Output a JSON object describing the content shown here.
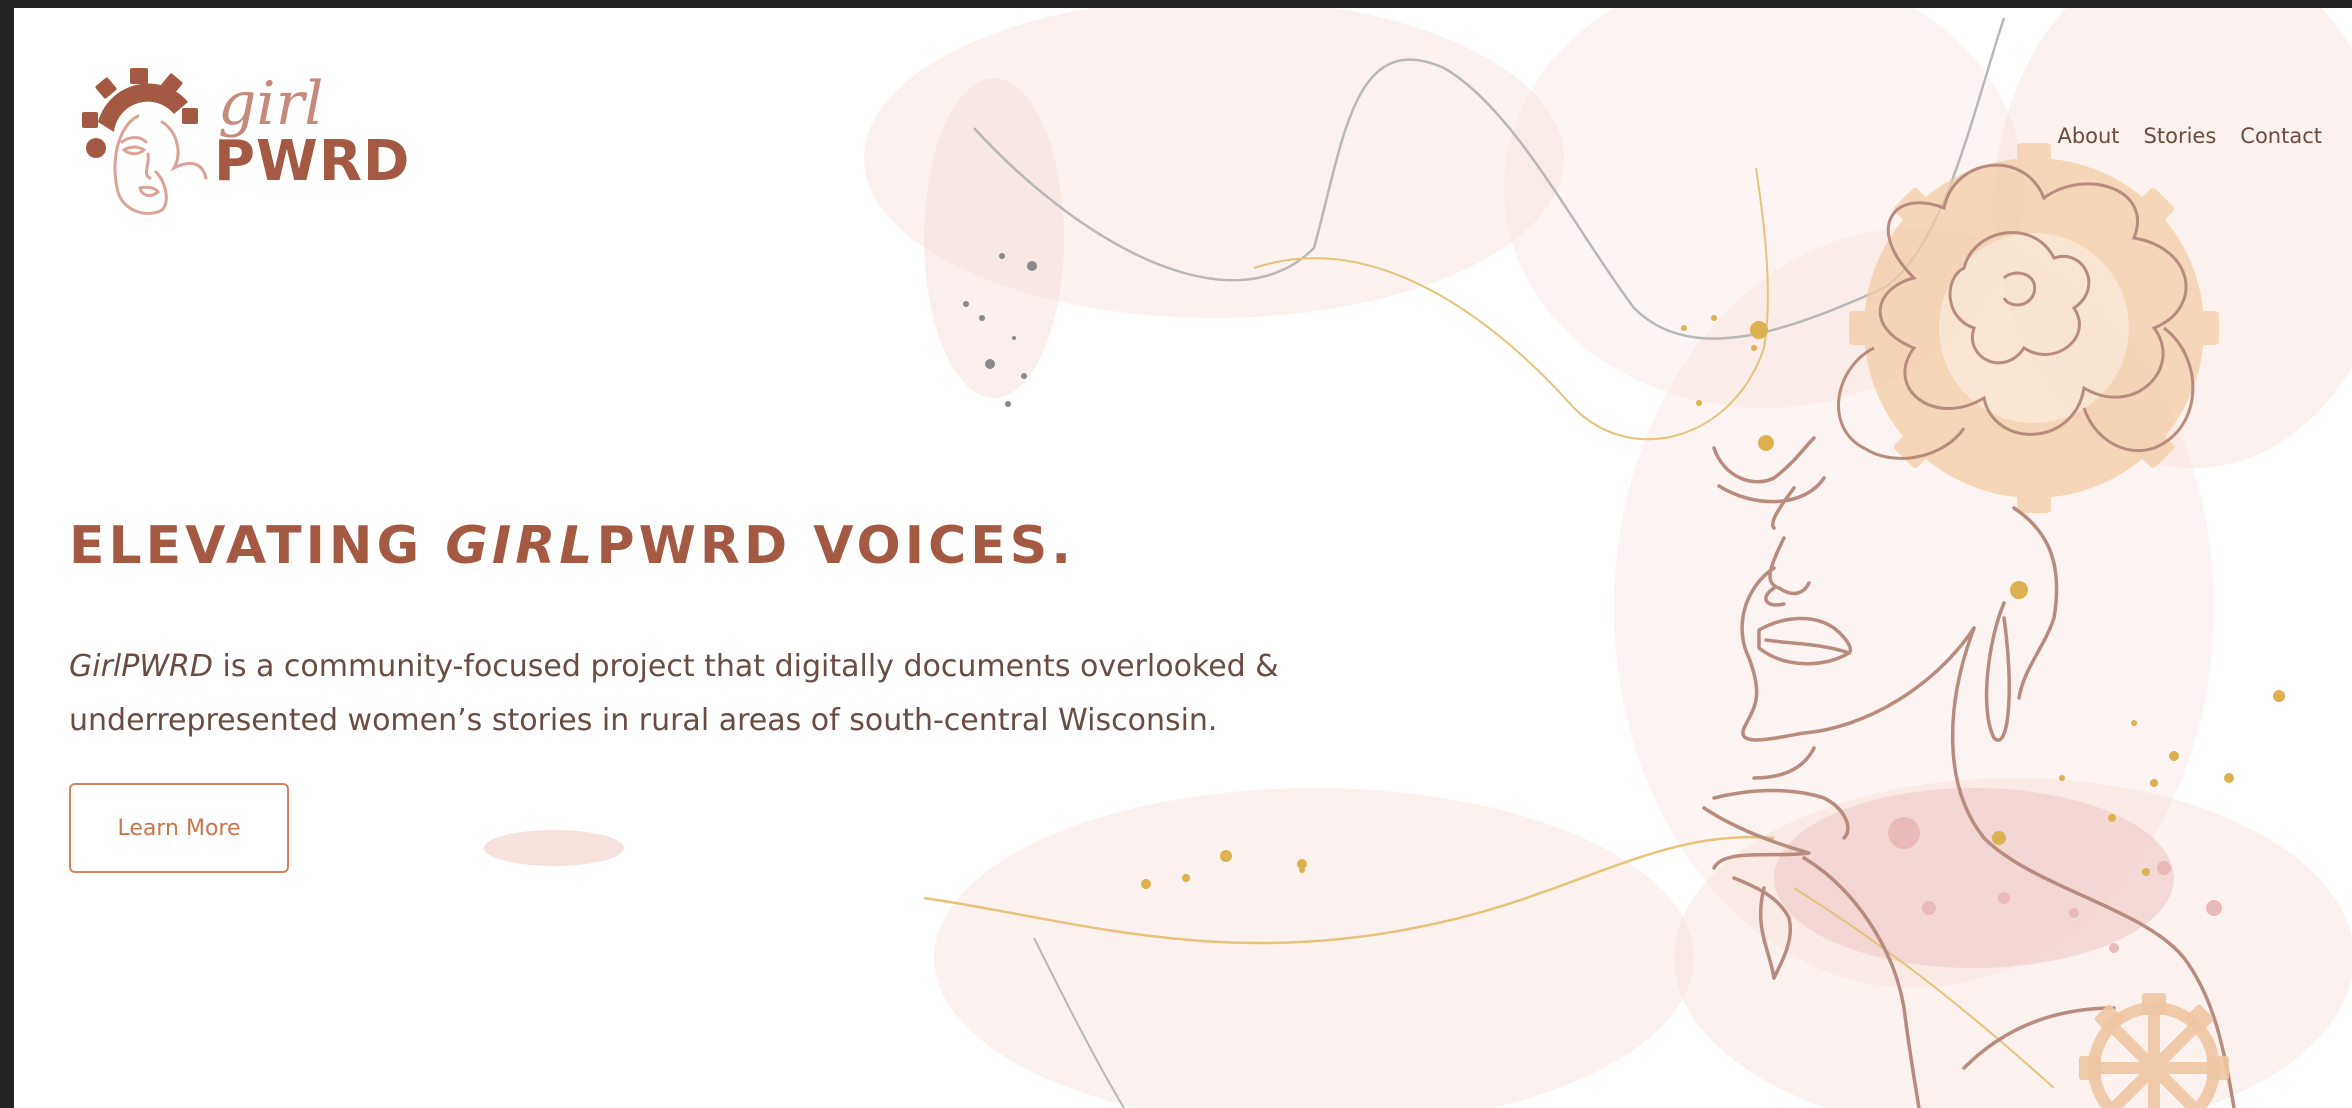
{
  "brand": {
    "logo_top": "girl",
    "logo_bottom": "PWRD",
    "colors": {
      "primary": "#a45a42",
      "accent": "#d4845d",
      "text": "#6a4c43",
      "blush": "#f3d8d2",
      "gold": "#e0b04c"
    }
  },
  "nav": {
    "items": [
      {
        "label": "About"
      },
      {
        "label": "Stories"
      },
      {
        "label": "Contact"
      }
    ]
  },
  "hero": {
    "headline_prefix": "ELEVATING ",
    "headline_em": "GIRL",
    "headline_suffix": "PWRD VOICES.",
    "desc_em": "GirlPWRD",
    "desc_rest": " is a community-focused project that digitally documents overlooked & underrepresented women’s stories in rural areas of south-central Wisconsin.",
    "cta_label": "Learn More"
  },
  "icons": {
    "logo": "gear-face-logo-icon",
    "illustration": "woman-line-art-with-flower-and-gears"
  }
}
